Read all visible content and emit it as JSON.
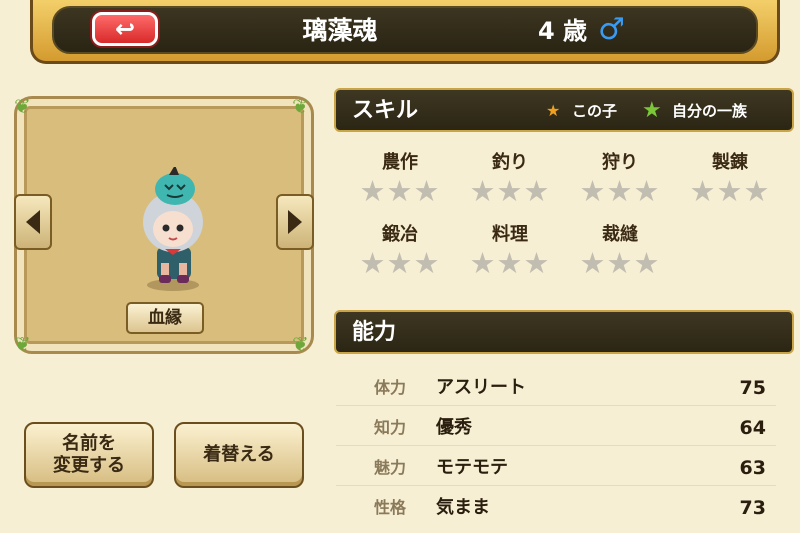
{
  "header": {
    "back_icon": "↩",
    "name": "璃藻魂",
    "age": "4 歳",
    "gender_icon": "♂"
  },
  "portrait": {
    "lineage_label": "血縁"
  },
  "actions": {
    "rename_line1": "名前を",
    "rename_line2": "変更する",
    "change_clothes": "着替える"
  },
  "skills_section": {
    "title": "スキル",
    "legend_this_child": "この子",
    "legend_clan": "自分の一族",
    "items": [
      {
        "name": "農作",
        "stars": 3
      },
      {
        "name": "釣り",
        "stars": 3
      },
      {
        "name": "狩り",
        "stars": 3
      },
      {
        "name": "製錬",
        "stars": 3
      },
      {
        "name": "鍛冶",
        "stars": 3
      },
      {
        "name": "料理",
        "stars": 3
      },
      {
        "name": "裁縫",
        "stars": 3
      }
    ]
  },
  "abilities_section": {
    "title": "能力",
    "rows": [
      {
        "label": "体力",
        "desc": "アスリート",
        "value": "75"
      },
      {
        "label": "知力",
        "desc": "優秀",
        "value": "64"
      },
      {
        "label": "魅力",
        "desc": "モテモテ",
        "value": "63"
      },
      {
        "label": "性格",
        "desc": "気まま",
        "value": "73"
      }
    ]
  },
  "colors": {
    "this_child_star": "#f0a020",
    "clan_star": "#7cc63a",
    "empty_star": "#c2bdb1",
    "gender": "#3a9bf0"
  }
}
